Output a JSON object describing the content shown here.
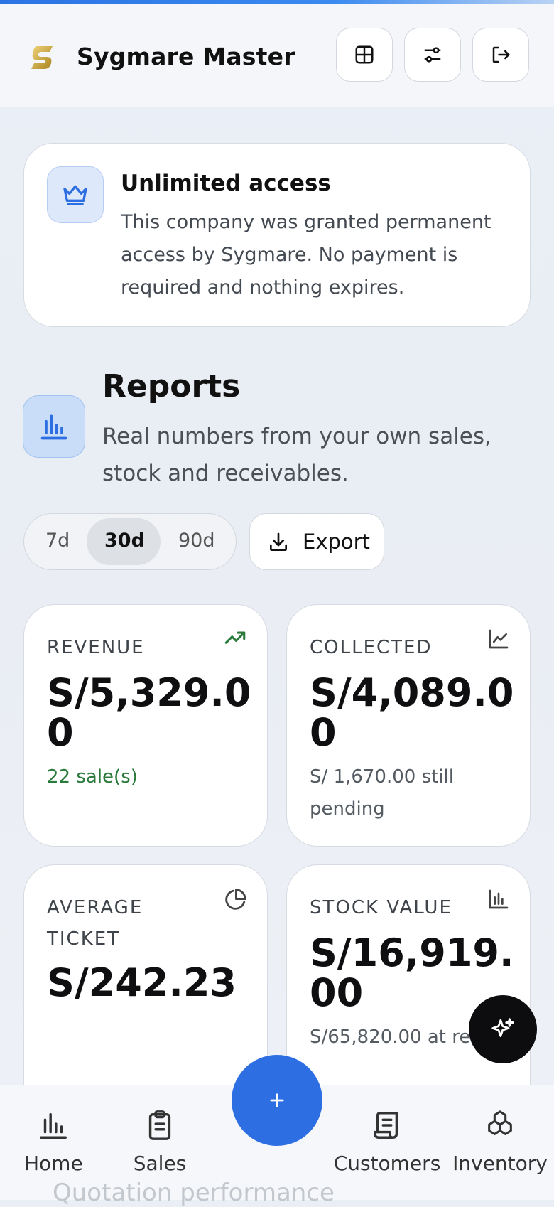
{
  "header": {
    "brand": "Sygmare Master"
  },
  "access": {
    "title": "Unlimited access",
    "body": "This company was granted permanent access by Sygmare. No payment is required and nothing expires."
  },
  "reports": {
    "title": "Reports",
    "subtitle": "Real numbers from your own sales, stock and receivables."
  },
  "range": {
    "options": [
      "7d",
      "30d",
      "90d"
    ],
    "selected": "30d"
  },
  "export_label": "Export",
  "stats": {
    "revenue": {
      "label": "REVENUE",
      "value": "S/5,329.00",
      "note": "22 sale(s)"
    },
    "collected": {
      "label": "COLLECTED",
      "value": "S/4,089.00",
      "note": "S/ 1,670.00 still pending"
    },
    "avg_ticket": {
      "label": "AVERAGE TICKET",
      "value": "S/242.23"
    },
    "stock_value": {
      "label": "STOCK VALUE",
      "value": "S/16,919.00",
      "note": "S/65,820.00 at retail"
    }
  },
  "partial_section_title": "Quotation performance",
  "nav": {
    "home": "Home",
    "sales": "Sales",
    "customers": "Customers",
    "inventory": "Inventory"
  },
  "colors": {
    "accent": "#2d6fe3",
    "positive": "#2a7a3b",
    "logo_gold": "#c9a227"
  }
}
